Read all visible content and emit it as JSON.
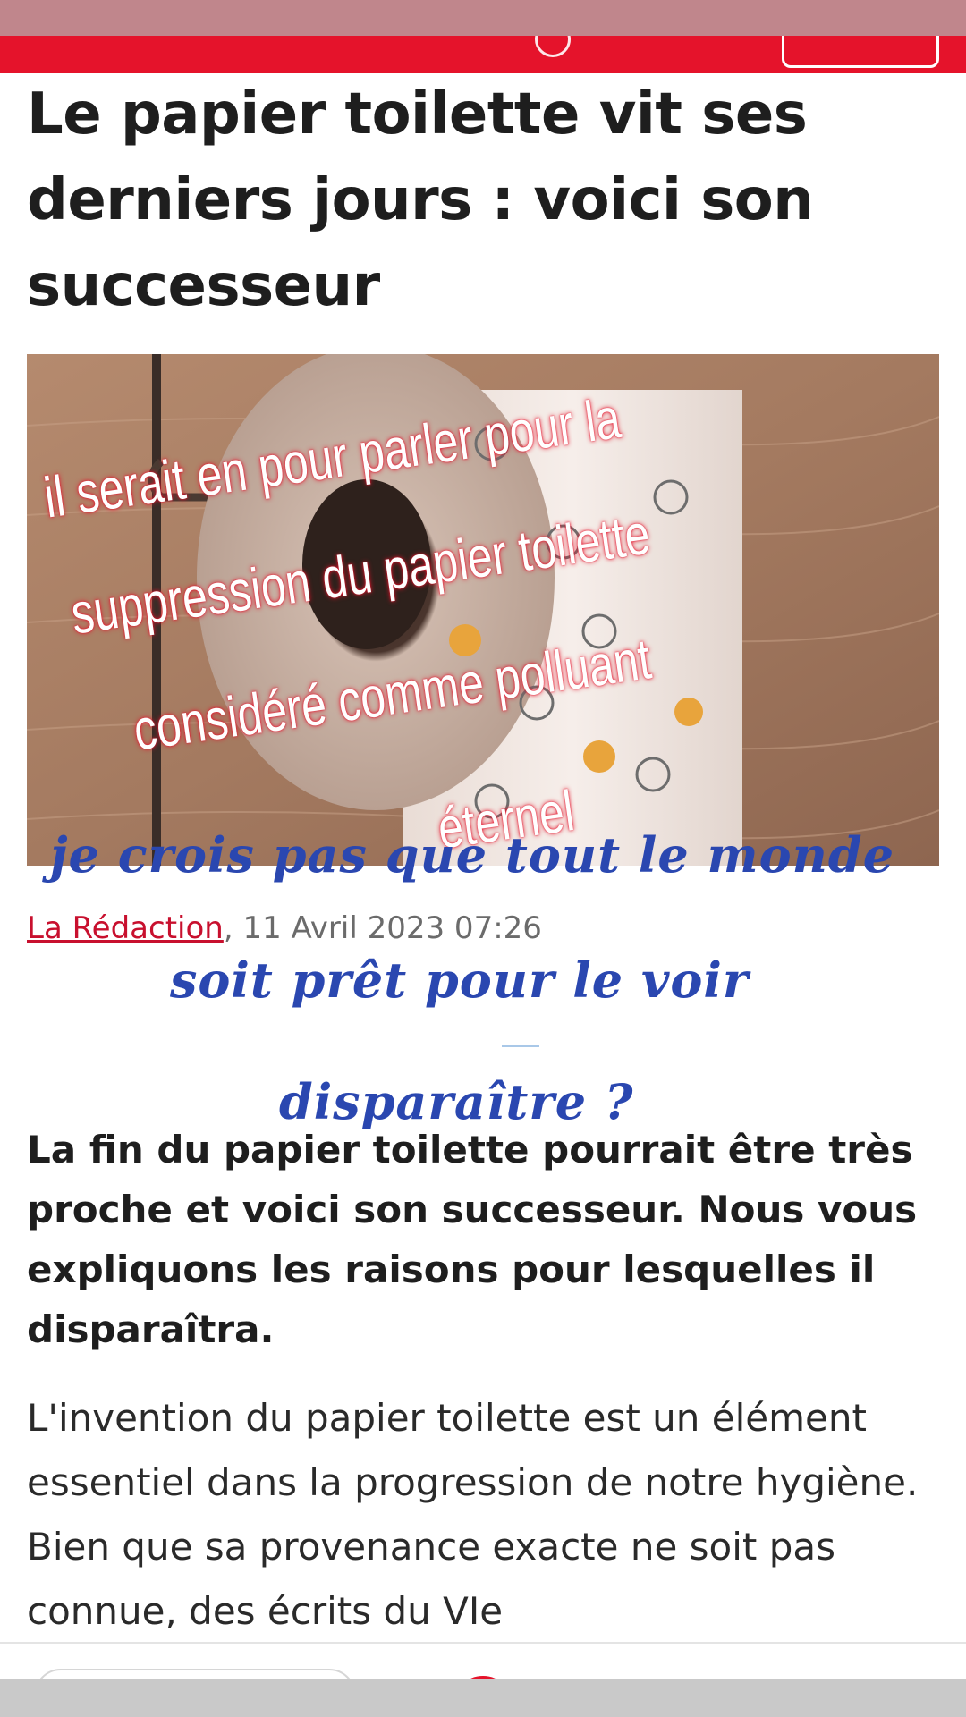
{
  "article": {
    "headline": "Le papier toilette vit ses derniers jours : voici son successeur",
    "author": "La Rédaction",
    "date": ", 11 Avril 2023 07:26",
    "lead": "La fin du papier toilette pourrait être très proche et voici son successeur. Nous vous expliquons les raisons pour lesquelles il disparaîtra.",
    "body": "L'invention du papier toilette est un élément essentiel dans la progression de notre hygiène. Bien que sa provenance exacte ne soit pas connue, des écrits du VIe"
  },
  "overlay": {
    "caption_lines": [
      "il serait en pour parler pour la",
      "suppression du papier toilette",
      "considéré comme polluant",
      "éternel"
    ],
    "script_lines": [
      "je crois pas que tout le monde",
      "soit prêt pour le voir",
      "disparaître ?"
    ]
  },
  "colors": {
    "brand_red": "#e5132b",
    "caption_glow": "#e5132b",
    "script_blue": "#2a47b0",
    "author_link": "#c8102e"
  }
}
